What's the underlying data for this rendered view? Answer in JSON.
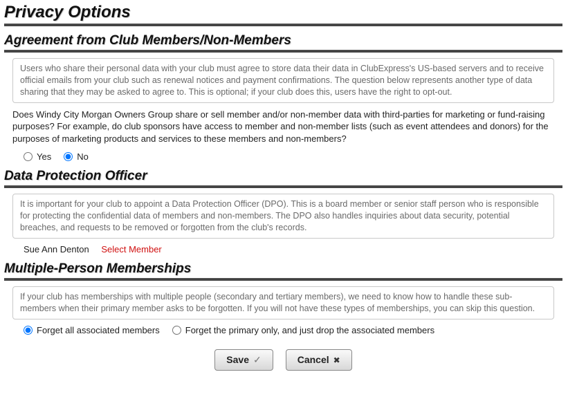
{
  "page": {
    "title": "Privacy Options"
  },
  "agreement": {
    "heading": "Agreement from Club Members/Non-Members",
    "info": "Users who share their personal data with your club must agree to store data their data in ClubExpress's US-based servers and to receive official emails from your club such as renewal notices and payment confirmations. The question below represents another type of data sharing that they may be asked to agree to. This is optional; if your club does this, users have the right to opt-out.",
    "question": "Does Windy City Morgan Owners Group share or sell member and/or non-member data with third-parties for marketing or fund-raising purposes? For example, do club sponsors have access to member and non-member lists (such as event attendees and donors) for the purposes of marketing products and services to these members and non-members?",
    "yes_label": "Yes",
    "no_label": "No",
    "selected": "no"
  },
  "dpo": {
    "heading": "Data Protection Officer",
    "info": "It is important for your club to appoint a Data Protection Officer (DPO). This is a board member or senior staff person who is responsible for protecting the confidential data of members and non-members. The DPO also handles inquiries about data security, potential breaches, and requests to be removed or forgotten from the club's records.",
    "member_name": "Sue Ann Denton",
    "select_link": "Select Member"
  },
  "multi": {
    "heading": "Multiple-Person Memberships",
    "info": "If your club has memberships with multiple people (secondary and tertiary members), we need to know how to handle these sub-members when their primary member asks to be forgotten. If you will not have these types of memberships, you can skip this question.",
    "opt_all_label": "Forget all associated members",
    "opt_primary_label": "Forget the primary only, and just drop the associated members",
    "selected": "all"
  },
  "buttons": {
    "save": "Save",
    "cancel": "Cancel"
  }
}
